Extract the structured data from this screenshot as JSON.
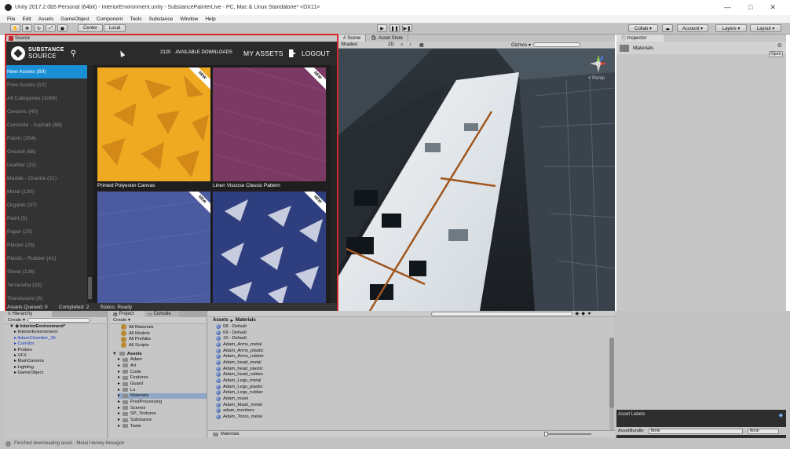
{
  "window": {
    "title": "Unity 2017.2.0b5 Personal (64bit) - InteriorEnvironment.unity - SubstancePainterLive - PC, Mac & Linux Standalone* <DX11>",
    "controls": [
      "—",
      "□",
      "✕"
    ]
  },
  "menu": [
    "File",
    "Edit",
    "Assets",
    "GameObject",
    "Component",
    "Tools",
    "Substance",
    "Window",
    "Help"
  ],
  "toolbar": {
    "pivot": "Center",
    "space": "Local",
    "collab": "Collab ▾",
    "account": "Account ▾",
    "layers": "Layers ▾",
    "layout": "Layout ▾",
    "play_icon": "play-icon",
    "pause_icon": "pause-icon",
    "step_icon": "step-icon"
  },
  "substance": {
    "tab_label": "Source",
    "brand_top": "SUBSTANCE",
    "brand_bottom": "SOURCE",
    "download_count": "2120",
    "download_label": "AVAILABLE DOWNLOADS",
    "my_assets": "MY ASSETS",
    "logout": "LOGOUT",
    "categories": [
      "New Assets (69)",
      "Free Assets (12)",
      "All Categories (1069)",
      "Ceramic (40)",
      "Concrete - Asphalt (89)",
      "Fabric (254)",
      "Ground (68)",
      "Leather (22)",
      "Marble - Granite (21)",
      "Metal (130)",
      "Organic (37)",
      "Paint (5)",
      "Paper (25)",
      "Plaster (25)",
      "Plastic - Rubber (41)",
      "Stone (136)",
      "Terracotta (33)",
      "Translucent (6)"
    ],
    "selected_category": 0,
    "assets": [
      {
        "name": "Printed Polyester Canvas",
        "badge": "NEW",
        "color": "#f0aa22"
      },
      {
        "name": "Linen Viscose Classic Pattern",
        "badge": "NEW",
        "color": "#7a3a63"
      },
      {
        "name": "",
        "badge": "NEW",
        "color": "#4c5aa0"
      },
      {
        "name": "",
        "badge": "NEW",
        "color": "#2f3e7e"
      }
    ],
    "status": {
      "queued": "Assets Queued: 0",
      "completed": "Completed: 2",
      "state": "Status: Ready"
    }
  },
  "scene": {
    "tabs": [
      "Scene",
      "Asset Store"
    ],
    "shading": "Shaded",
    "mode_2d": "2D",
    "gizmos": "Gizmos ▾",
    "persp": "< Persp"
  },
  "inspector": {
    "tab": "Inspector",
    "item": "Materials",
    "open_btn": "Open"
  },
  "hierarchy": {
    "tab": "Hierarchy",
    "create": "Create ▾",
    "root": "InteriorEnvironment*",
    "items": [
      {
        "label": "InteriorEnvironment",
        "blue": false
      },
      {
        "label": "AdamChamber_36",
        "blue": true
      },
      {
        "label": "Corridor",
        "blue": true
      },
      {
        "label": "Probes",
        "blue": false
      },
      {
        "label": "VFX",
        "blue": false
      },
      {
        "label": "MainCamera",
        "blue": false
      },
      {
        "label": "Lighting",
        "blue": false
      },
      {
        "label": "GameObject",
        "blue": false
      }
    ]
  },
  "project": {
    "tabs": [
      "Project",
      "Console"
    ],
    "create": "Create ▾",
    "favorites": [
      "All Materials",
      "All Models",
      "All Prefabs",
      "All Scripts"
    ],
    "assets_root": "Assets",
    "folders": [
      "Adam",
      "Art",
      "Code",
      "Features",
      "Guard",
      "Lu",
      "Materials",
      "PostProcessing",
      "Scenes",
      "SP_Textures",
      "Substance",
      "Taste"
    ],
    "selected_folder": 6,
    "breadcrumb_root": "Assets",
    "breadcrumb_current": "Materials",
    "materials": [
      "08 - Default",
      "09 - Default",
      "15 - Default",
      "Adam_Arms_metal",
      "Adam_Arms_plastic",
      "Adam_Arms_rubber",
      "Adam_head_metal",
      "Adam_head_plastic",
      "Adam_head_rubber",
      "Adam_Legs_metal",
      "Adam_Legs_plastic",
      "Adam_Legs_rubber",
      "Adam_mask",
      "Adam_Mask_metal",
      "adam_monitors",
      "Adam_Torso_metal"
    ],
    "footer": "Materials"
  },
  "asset_labels": {
    "title": "Asset Labels",
    "bundle_label": "AssetBundle",
    "bundle_value": "None",
    "variant_value": "None"
  },
  "status_bar": {
    "message": "Finished downloading asset - Metal Harvey Hexagon"
  }
}
